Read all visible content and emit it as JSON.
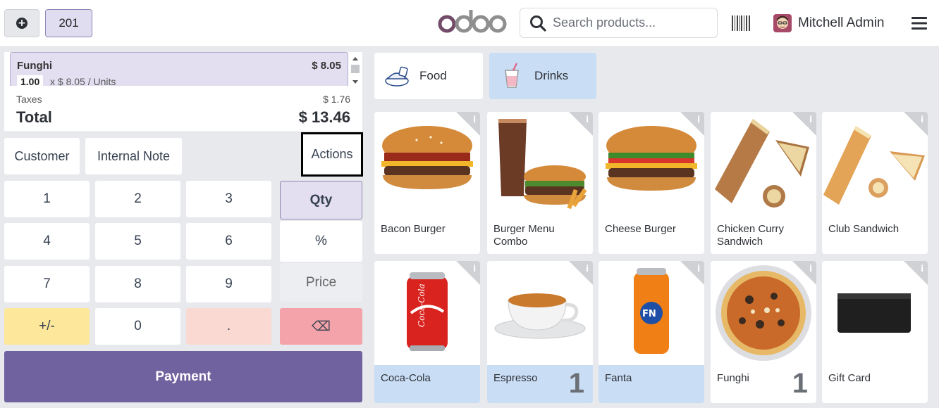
{
  "topbar": {
    "new_order_icon": "plus-circle-icon",
    "order_number": "201",
    "logo_text": "odoo",
    "search_placeholder": "Search products...",
    "barcode_icon": "barcode-icon",
    "user_name": "Mitchell Admin",
    "menu_icon": "hamburger-icon"
  },
  "order": {
    "lines": [
      {
        "name": "Funghi",
        "price": "$ 8.05",
        "qty": "1.00",
        "detail": "x $ 8.05 / Units"
      }
    ],
    "taxes_label": "Taxes",
    "taxes_value": "$ 1.76",
    "total_label": "Total",
    "total_value": "$ 13.46"
  },
  "controls": {
    "customer": "Customer",
    "internal_note": "Internal Note",
    "actions": "Actions"
  },
  "numpad": {
    "keys": [
      "1",
      "2",
      "3",
      "4",
      "5",
      "6",
      "7",
      "8",
      "9",
      "+/-",
      "0",
      "."
    ],
    "modes": [
      "Qty",
      "%",
      "Price"
    ],
    "backspace": "⌫",
    "active_mode": "Qty"
  },
  "payment_label": "Payment",
  "categories": [
    {
      "label": "Food",
      "icon": "food-icon",
      "active": false
    },
    {
      "label": "Drinks",
      "icon": "drinks-icon",
      "active": true
    }
  ],
  "products": [
    {
      "name": "Bacon Burger",
      "image": "bacon-burger",
      "selected": false,
      "qty": ""
    },
    {
      "name": "Burger Menu Combo",
      "image": "burger-combo",
      "selected": false,
      "qty": ""
    },
    {
      "name": "Cheese Burger",
      "image": "cheese-burger",
      "selected": false,
      "qty": ""
    },
    {
      "name": "Chicken Curry Sandwich",
      "image": "chicken-sandwich",
      "selected": false,
      "qty": ""
    },
    {
      "name": "Club Sandwich",
      "image": "club-sandwich",
      "selected": false,
      "qty": ""
    },
    {
      "name": "Coca-Cola",
      "image": "coca-cola-can",
      "selected": true,
      "qty": ""
    },
    {
      "name": "Espresso",
      "image": "espresso-cup",
      "selected": true,
      "qty": "1"
    },
    {
      "name": "Fanta",
      "image": "fanta-can",
      "selected": true,
      "qty": ""
    },
    {
      "name": "Funghi",
      "image": "pizza",
      "selected": false,
      "qty": "1"
    },
    {
      "name": "Gift Card",
      "image": "gift-card",
      "selected": false,
      "qty": ""
    }
  ],
  "colors": {
    "accent": "#70619f",
    "selected_bg": "#c9ddf5",
    "qty_bg": "#e3dff0"
  }
}
